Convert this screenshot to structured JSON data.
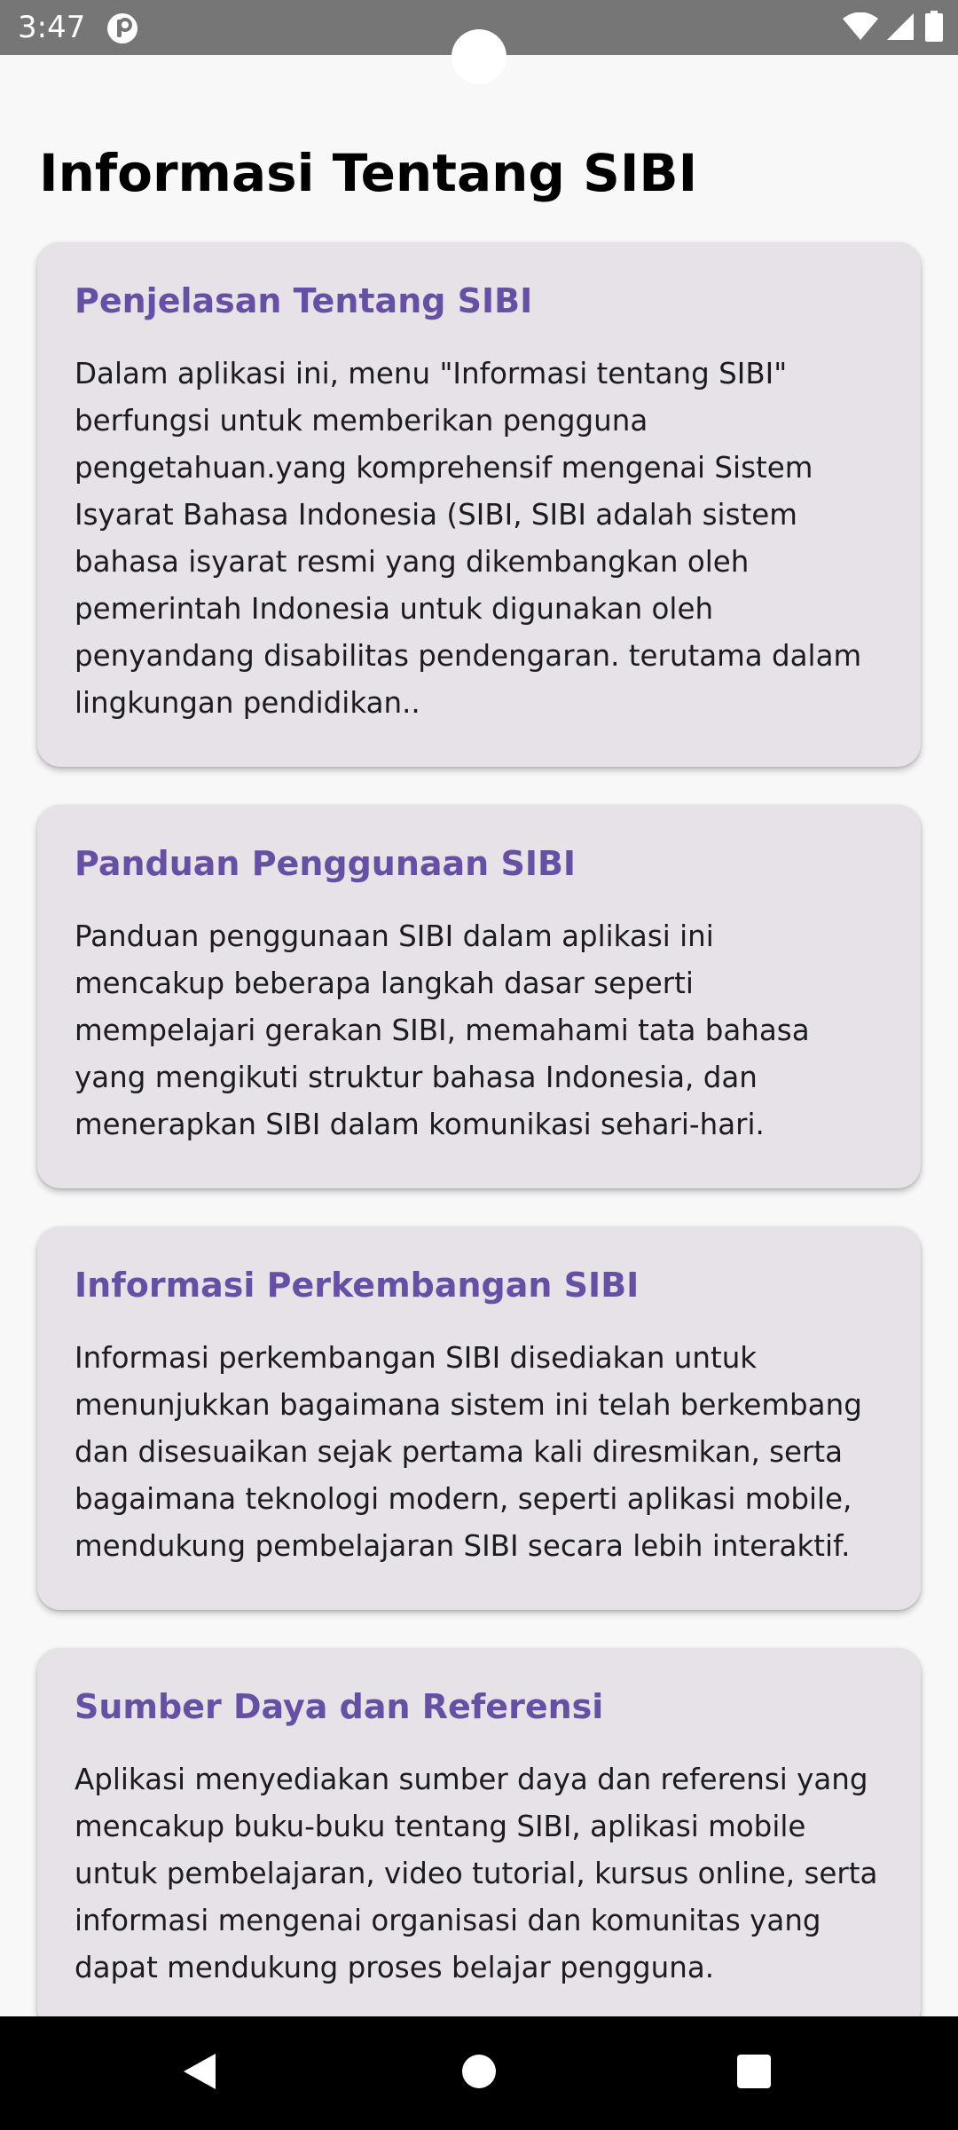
{
  "status_bar": {
    "time": "3:47",
    "icons": [
      "app-notification-icon",
      "wifi-icon",
      "cellular-signal-icon",
      "battery-icon"
    ]
  },
  "page": {
    "title": "Informasi Tentang SIBI"
  },
  "cards": [
    {
      "title": "Penjelasan Tentang SIBI",
      "body": "Dalam aplikasi ini, menu \"Informasi tentang SIBI\"\nberfungsi untuk memberikan pengguna\npengetahuan.yang komprehensif mengenai Sistem\nIsyarat Bahasa Indonesia (SIBI, SIBI adalah sistem\nbahasa isyarat resmi yang dikembangkan oleh\npemerintah Indonesia untuk digunakan oleh\npenyandang disabilitas pendengaran.  terutama dalam\nlingkungan pendidikan.."
    },
    {
      "title": "Panduan Penggunaan SIBI",
      "body": "Panduan penggunaan SIBI dalam aplikasi ini\nmencakup beberapa langkah dasar seperti\nmempelajari gerakan SIBI, memahami tata bahasa\nyang mengikuti struktur bahasa Indonesia, dan\nmenerapkan SIBI dalam komunikasi sehari-hari."
    },
    {
      "title": "Informasi Perkembangan SIBI",
      "body": "Informasi perkembangan SIBI disediakan untuk\nmenunjukkan bagaimana sistem ini telah berkembang\ndan disesuaikan sejak pertama kali diresmikan, serta\nbagaimana teknologi modern, seperti aplikasi mobile,\nmendukung pembelajaran SIBI secara lebih interaktif."
    },
    {
      "title": "Sumber Daya dan Referensi",
      "body": "Aplikasi menyediakan sumber daya dan referensi yang\nmencakup buku-buku tentang SIBI, aplikasi mobile\nuntuk pembelajaran, video tutorial, kursus online, serta\ninformasi mengenai organisasi dan komunitas yang\ndapat mendukung proses belajar pengguna."
    }
  ],
  "nav_bar": {
    "buttons": [
      "back-icon",
      "home-icon",
      "recents-icon"
    ]
  },
  "colors": {
    "status_bar": "#767676",
    "background": "#f8f8f8",
    "card": "#e7e1e8",
    "card_title": "#6650a4",
    "nav_bar": "#000000"
  }
}
